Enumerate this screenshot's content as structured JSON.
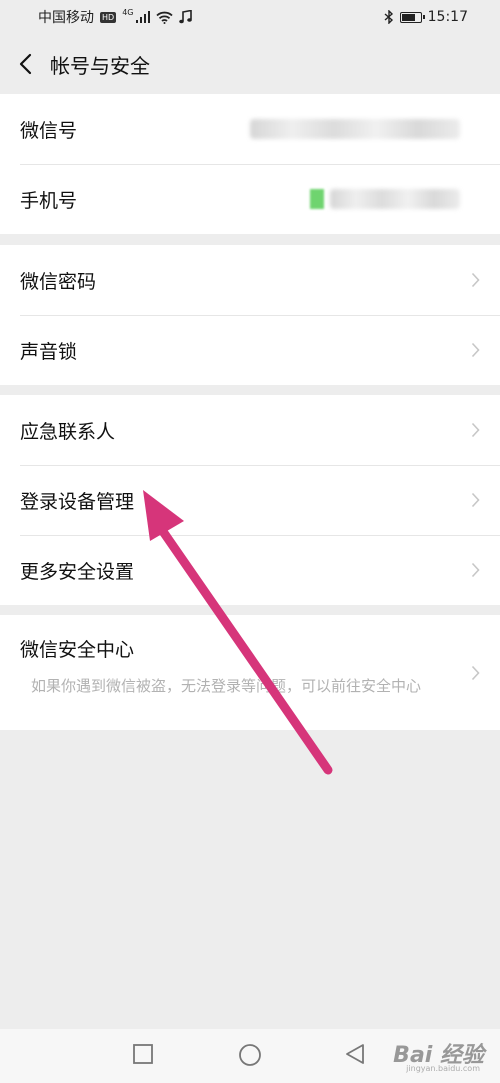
{
  "status_bar": {
    "carrier": "中国移动",
    "hd": "HD",
    "network": "4G",
    "time": "15:17",
    "battery_level": 0.75
  },
  "header": {
    "title": "帐号与安全"
  },
  "groups": {
    "account": {
      "wechat_id_label": "微信号",
      "phone_label": "手机号"
    },
    "password": {
      "password_label": "微信密码",
      "voice_lock_label": "声音锁"
    },
    "devices": {
      "emergency_contact_label": "应急联系人",
      "device_management_label": "登录设备管理",
      "more_security_label": "更多安全设置"
    },
    "security_center": {
      "title": "微信安全中心",
      "desc": "如果你遇到微信被盗，无法登录等问题，可以前往安全中心"
    }
  },
  "watermark": {
    "text": "Bai 经验",
    "sub": "jingyan.baidu.com"
  },
  "colors": {
    "background": "#ededed",
    "annotation_arrow": "#d6357a",
    "secondary_text": "#b2b2b2"
  }
}
